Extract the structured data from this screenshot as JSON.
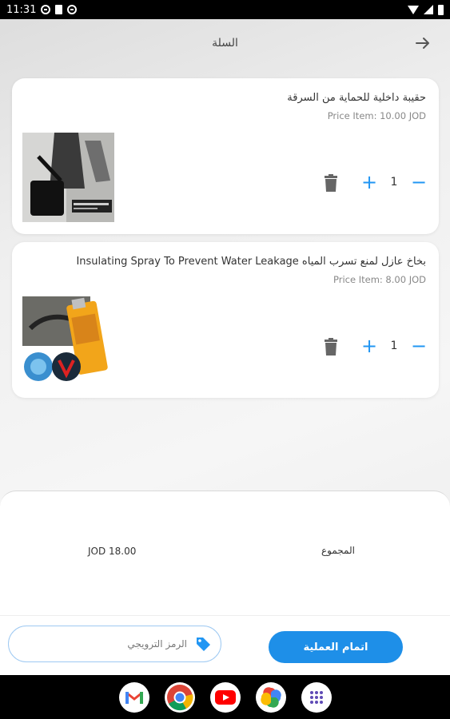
{
  "status_bar": {
    "time": "11:31"
  },
  "header": {
    "title": "السلة"
  },
  "cart": {
    "items": [
      {
        "title": "حقيبة داخلية للحماية من السرقة",
        "price": "Price Item: 10.00 JOD",
        "quantity": "1"
      },
      {
        "title": "بخاخ عازل لمنع تسرب المياه Insulating Spray To Prevent Water Leakage",
        "price": "Price Item: 8.00 JOD",
        "quantity": "1"
      }
    ]
  },
  "summary": {
    "total_label": "المجموع",
    "total_value": "JOD 18.00"
  },
  "actions": {
    "checkout_label": "اتمام العملية",
    "promo_placeholder": "الرمز الترويجي"
  },
  "colors": {
    "accent": "#2196f3",
    "checkout": "#1e8fe8"
  },
  "dock": {
    "apps": [
      {
        "name": "Gmail",
        "icon": "gmail-icon"
      },
      {
        "name": "Chrome",
        "icon": "chrome-icon"
      },
      {
        "name": "YouTube",
        "icon": "youtube-icon"
      },
      {
        "name": "Photos",
        "icon": "photos-icon"
      },
      {
        "name": "Apps",
        "icon": "app-drawer-icon"
      }
    ]
  }
}
